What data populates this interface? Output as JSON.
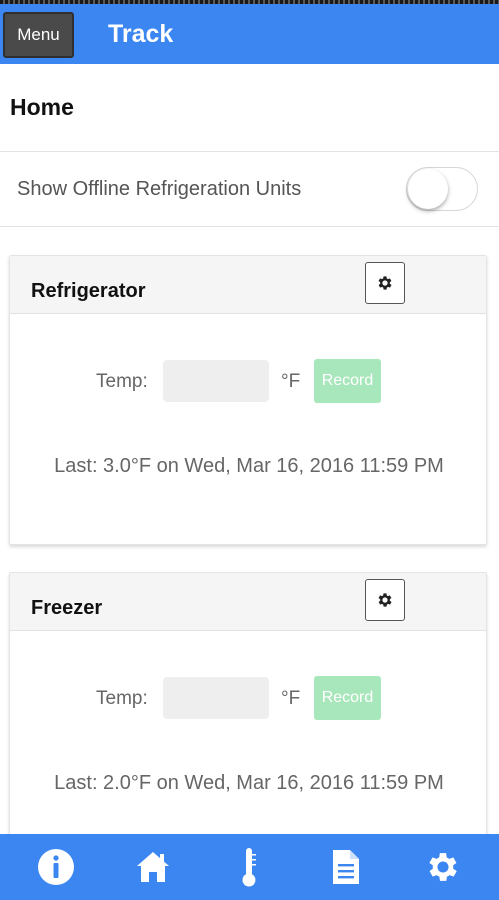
{
  "header": {
    "menu_label": "Menu",
    "title": "Track"
  },
  "page": {
    "title": "Home"
  },
  "offline_toggle": {
    "label": "Show Offline Refrigeration Units",
    "enabled": false
  },
  "units": [
    {
      "name": "Refrigerator",
      "temp_label": "Temp:",
      "temp_value": "",
      "unit": "°F",
      "record_label": "Record",
      "last_reading": "Last: 3.0°F on Wed, Mar 16, 2016 11:59 PM"
    },
    {
      "name": "Freezer",
      "temp_label": "Temp:",
      "temp_value": "",
      "unit": "°F",
      "record_label": "Record",
      "last_reading": "Last: 2.0°F on Wed, Mar 16, 2016 11:59 PM"
    }
  ],
  "bottom_nav": {
    "icons": [
      "info-icon",
      "home-icon",
      "thermometer-icon",
      "document-icon",
      "gear-icon"
    ]
  },
  "colors": {
    "brand": "#3b86f0",
    "record_button": "#a8e6bb",
    "menu_button": "#4a4a4a"
  }
}
